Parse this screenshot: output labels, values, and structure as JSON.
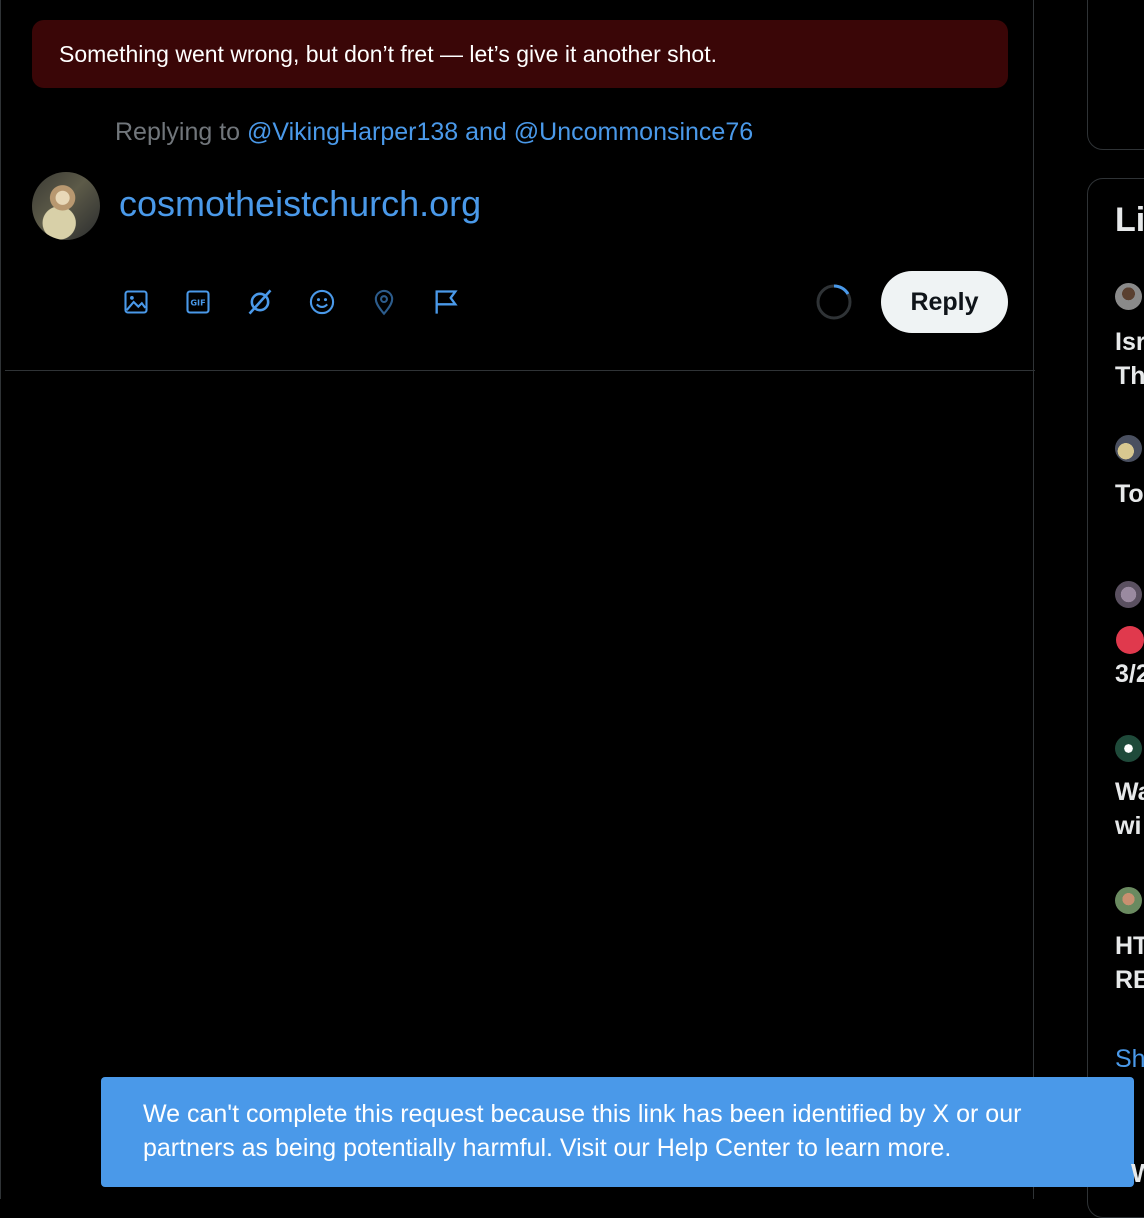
{
  "error_banner": {
    "text": "Something went wrong, but don’t fret — let’s give it another shot."
  },
  "compose": {
    "replying_prefix": "Replying to",
    "mentions": "@VikingHarper138 and @Uncommonsince76",
    "text": "cosmotheistchurch.org",
    "reply_label": "Reply",
    "tools": [
      "image-icon",
      "gif-icon",
      "grok-icon",
      "emoji-icon",
      "location-icon",
      "flag-icon"
    ],
    "gif_label": "GIF",
    "accent_color": "#4a99e9"
  },
  "right_column": {
    "title_fragment": "Li",
    "items": [
      {
        "line1": "Isr",
        "line2": "Th"
      },
      {
        "line1": "To",
        "line2": ""
      },
      {
        "line1": "",
        "line2": "3/2"
      },
      {
        "line1": "Wa",
        "line2": "wi"
      },
      {
        "line1": "HT",
        "line2": "RE"
      }
    ],
    "show_more_fragment": "Sh",
    "bottom_fragment": "W"
  },
  "toast": {
    "line1": "We can't complete this request because this link has been identified by X or our",
    "line2": "partners as being potentially harmful. Visit our Help Center to learn more.",
    "color": "#4a99e9"
  }
}
